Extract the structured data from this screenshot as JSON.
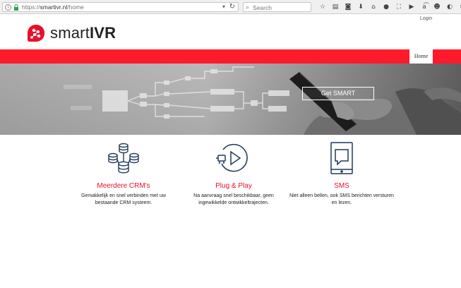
{
  "browser": {
    "url_prefix": "https://",
    "url_domain": "smartivr.nl",
    "url_path": "/home",
    "search_placeholder": "Search",
    "toolbar_icons": [
      "star-icon",
      "reading-list-icon",
      "pocket-icon",
      "download-icon",
      "home-icon",
      "chat-icon",
      "fullscreen-icon",
      "youtube-icon",
      "translate-icon",
      "emoji-icon",
      "dark-icon",
      "menu-icon"
    ]
  },
  "header": {
    "login_label": "Login",
    "logo_text_light": "smart",
    "logo_text_bold": "IVR"
  },
  "nav": {
    "items": [
      {
        "label": "Home"
      }
    ]
  },
  "hero": {
    "button_label": "Get SMART"
  },
  "features": [
    {
      "title": "Meerdere CRM's",
      "text": "Gemakkelijk en snel verbinden met uw bestaande CRM systeem.",
      "icon": "database-icon"
    },
    {
      "title": "Plug & Play",
      "text": "Na aanvraag snel beschikbaar, geen ingewikkelde ontwikkeltrajecten.",
      "icon": "plug-play-icon"
    },
    {
      "title": "SMS",
      "text": "Niet alleen bellen, ook SMS berichten versturen en lezen.",
      "icon": "sms-icon"
    }
  ],
  "colors": {
    "brand_red": "#ff1a2b",
    "title_red": "#e8112d",
    "icon_navy": "#1f3a5a"
  }
}
